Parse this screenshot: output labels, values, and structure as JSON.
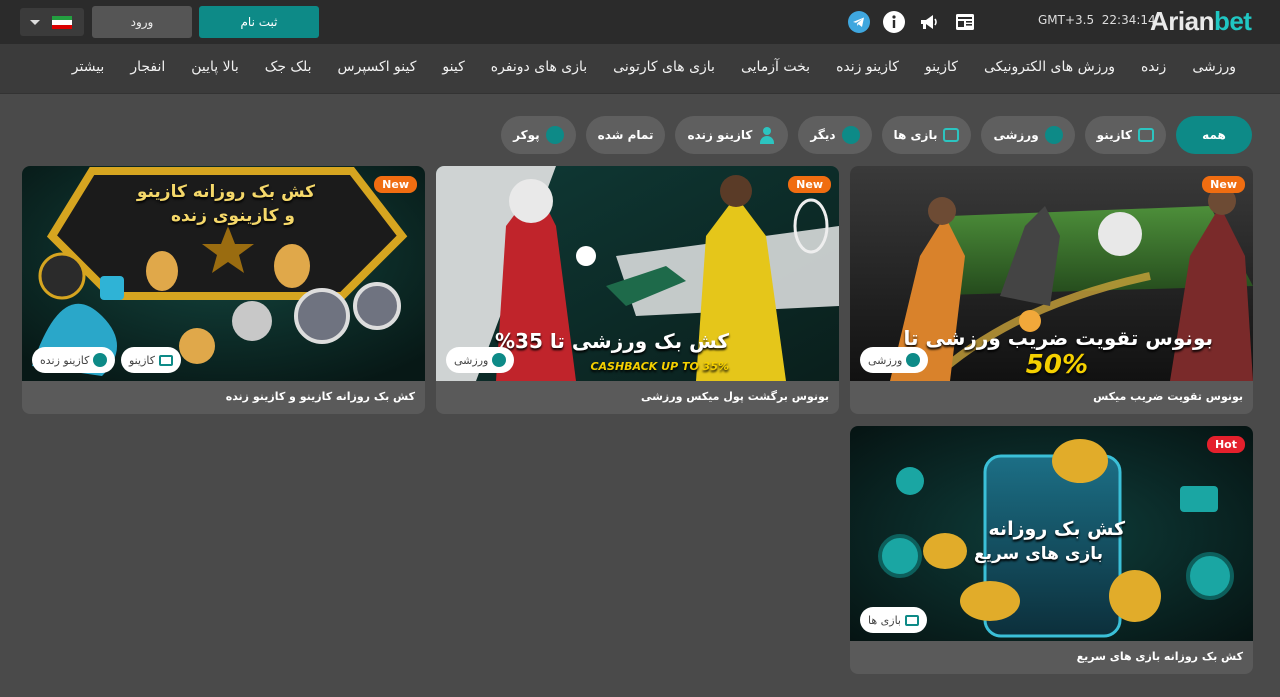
{
  "header": {
    "register_label": "ثبت نام",
    "login_label": "ورود",
    "timezone": "GMT+3.5",
    "time": "22:34:14",
    "logo_part1": "Arian",
    "logo_part2": "bet",
    "icons": [
      "telegram-icon",
      "info-icon",
      "megaphone-icon",
      "news-icon"
    ],
    "accent": "#0d8a87"
  },
  "nav": {
    "items": [
      "ورزشی",
      "زنده",
      "ورزش های الکترونیکی",
      "کازینو",
      "کازینو زنده",
      "بخت آزمایی",
      "بازی های کارتونی",
      "بازی های دونفره",
      "کینو",
      "کینو اکسپرس",
      "بلک جک",
      "بالا پایین",
      "انفجار",
      "بیشتر"
    ]
  },
  "filters": {
    "items": [
      "همه",
      "کازینو",
      "ورزشی",
      "بازی ها",
      "دیگر",
      "کازینو زنده",
      "تمام شده",
      "پوکر"
    ]
  },
  "cards": [
    {
      "badge": "New",
      "caption": "بونوس تقویت ضریب میکس",
      "tags": [
        "ورزشی"
      ],
      "banner_title": "بونوس تقویت ضریب ورزشی تا",
      "banner_sub": "50%"
    },
    {
      "badge": "New",
      "caption": "بونوس برگشت پول میکس ورزشی",
      "tags": [
        "ورزشی"
      ],
      "banner_title": "کش بک ورزشی تا 35%",
      "banner_sub": "CASHBACK UP TO 35%"
    },
    {
      "badge": "New",
      "caption": "کش بک روزانه کازینو و کازینو زنده",
      "tags": [
        "کازینو",
        "کازینو زنده"
      ],
      "banner_title": "کش بک روزانه کازینو",
      "banner_sub": "و کازینوی زنده"
    },
    {
      "badge": "Hot",
      "caption": "کش بک روزانه بازی های سریع",
      "tags": [
        "بازی ها"
      ],
      "banner_title": "کش بک روزانه",
      "banner_sub": "بازی های سریع"
    }
  ]
}
